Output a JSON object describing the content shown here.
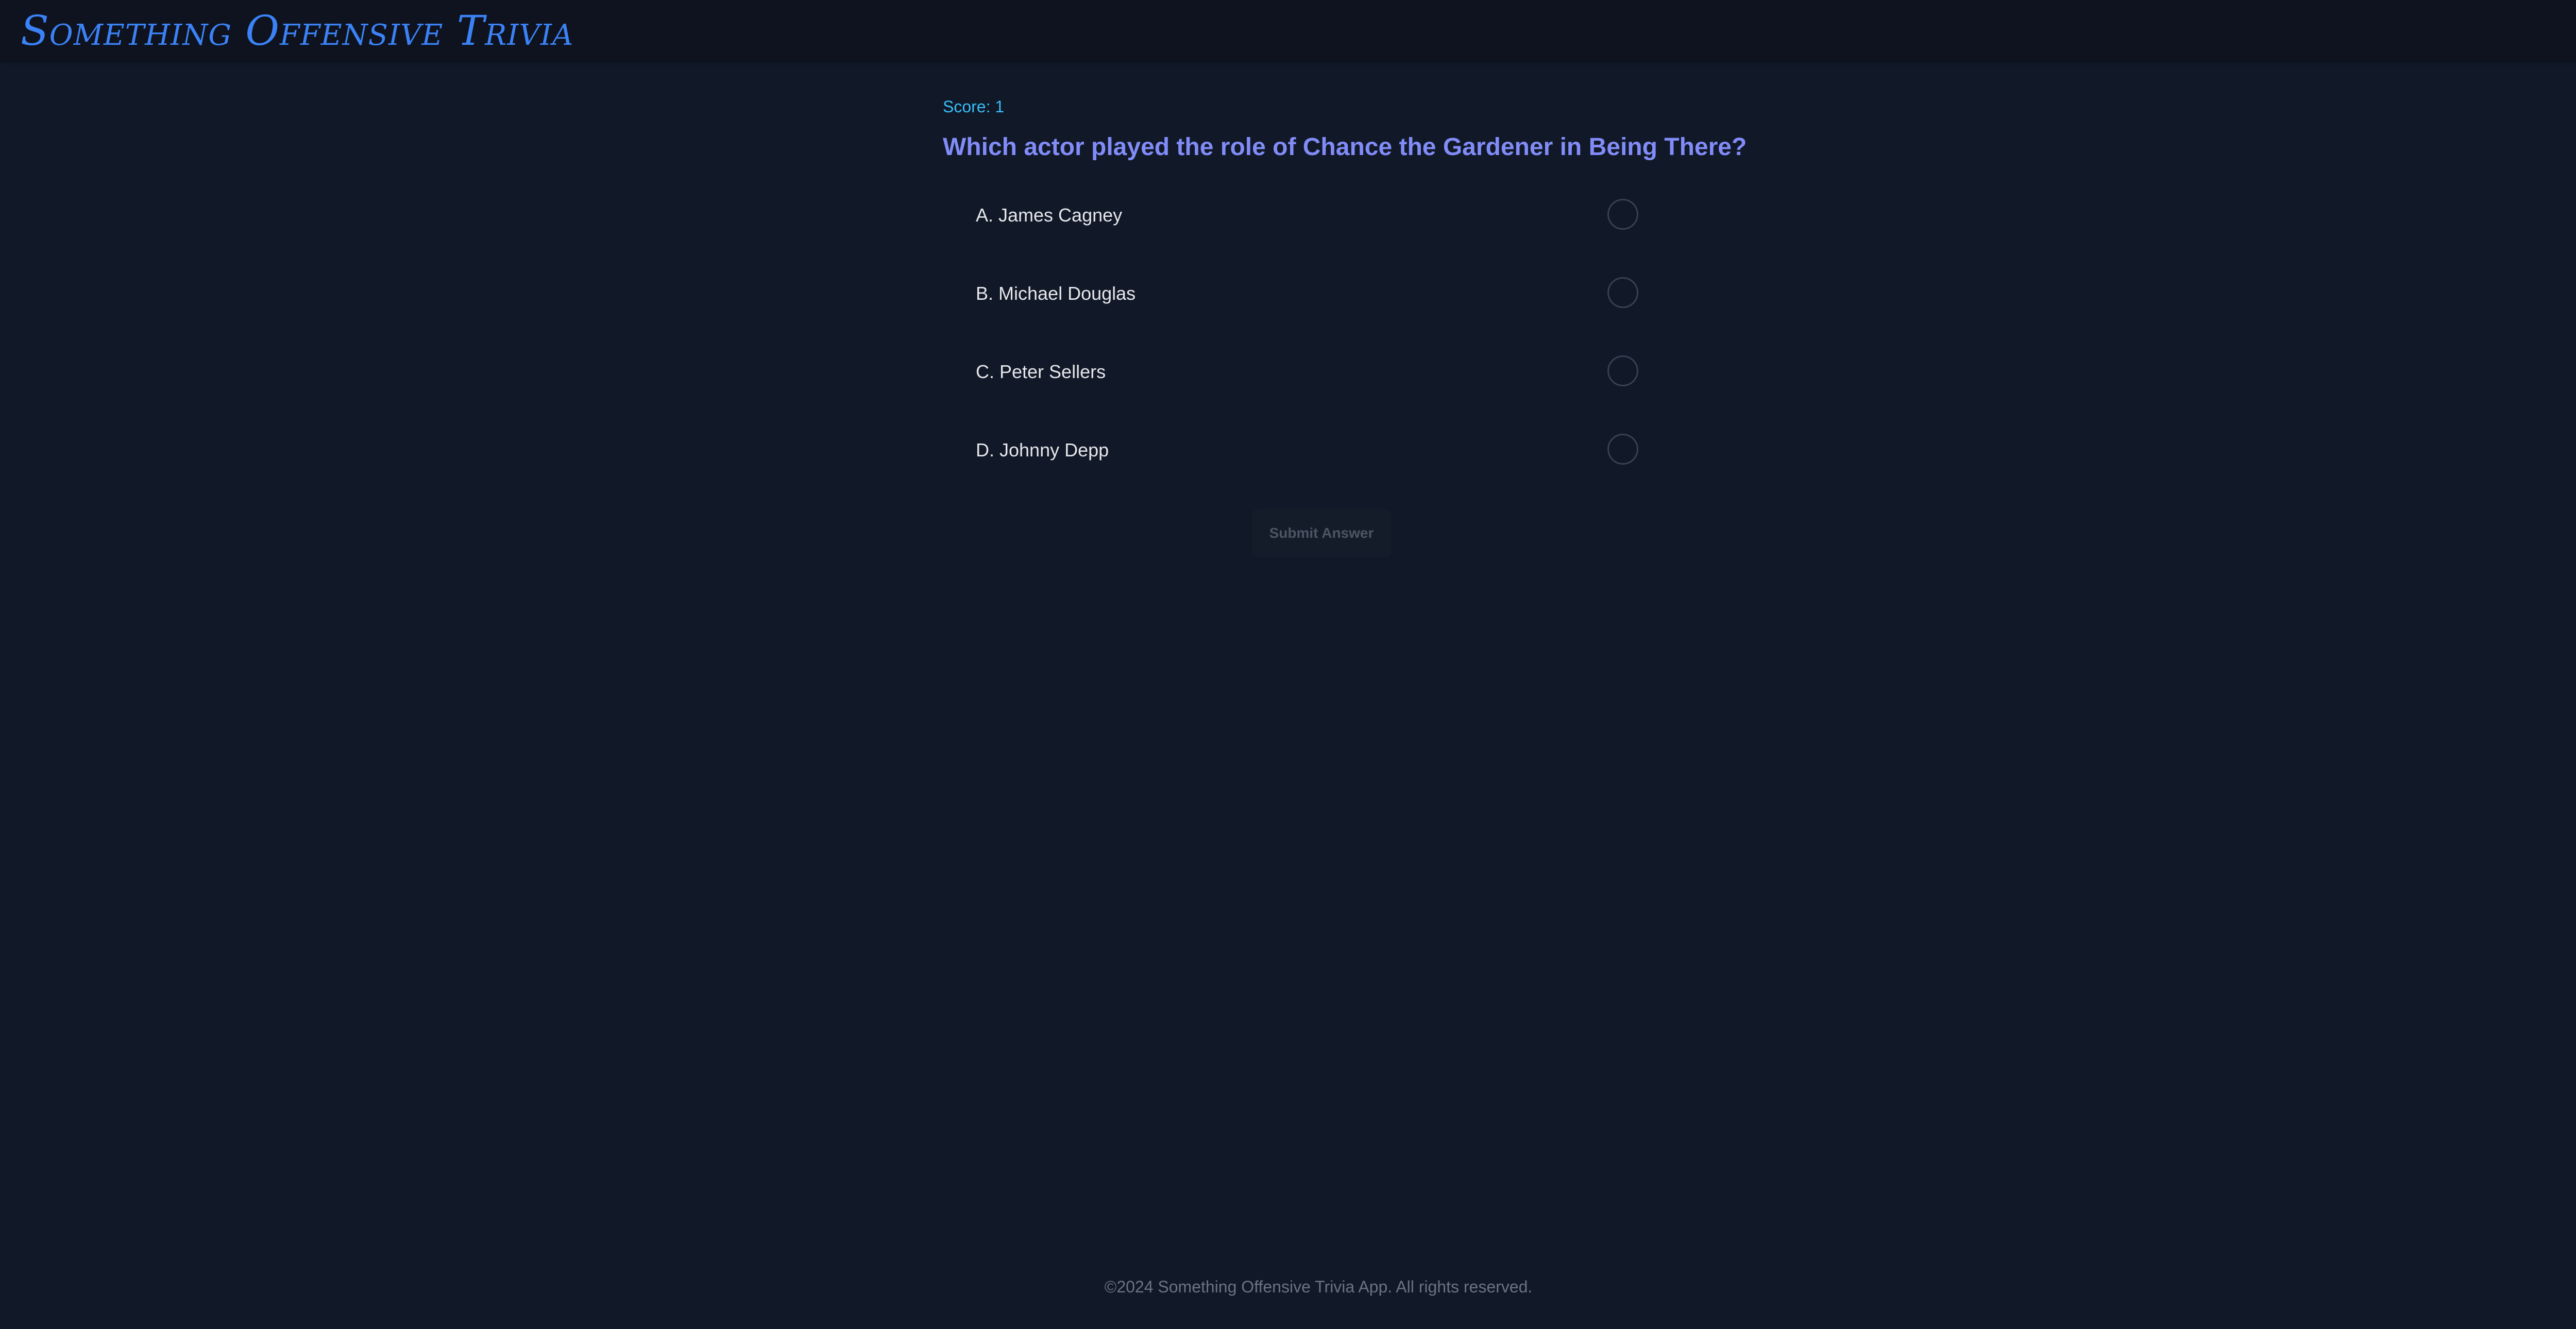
{
  "header": {
    "title": "Something Offensive Trivia",
    "info_icon": "info-circle-icon",
    "accent_color": "#3b82f6",
    "icon_color": "#818cf8"
  },
  "quiz": {
    "score_label": "Score: 1",
    "question": "Which actor played the role of Chance the Gardener in Being There?",
    "options": [
      {
        "label": "A. James Cagney",
        "selected": false
      },
      {
        "label": "B. Michael Douglas",
        "selected": false
      },
      {
        "label": "C. Peter Sellers",
        "selected": false
      },
      {
        "label": "D. Johnny Depp",
        "selected": false
      }
    ],
    "submit_label": "Submit Answer",
    "submit_disabled": true
  },
  "footer": {
    "text": "©2024 Something Offensive Trivia App. All rights reserved."
  },
  "colors": {
    "background": "#111827",
    "question": "#818cf8",
    "score": "#38bdf8"
  }
}
